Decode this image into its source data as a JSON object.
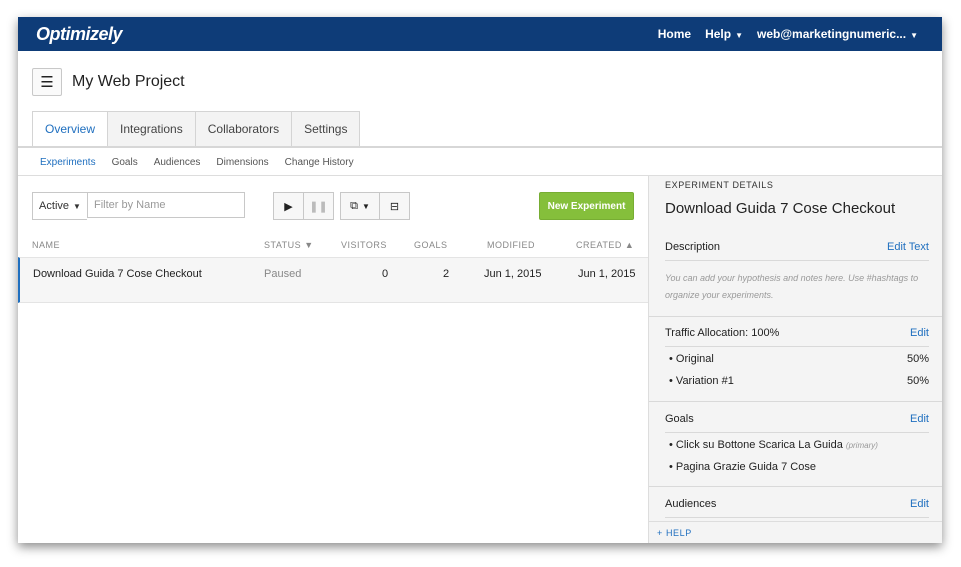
{
  "brand": {
    "logo": "Optimizely"
  },
  "topnav": {
    "home": "Home",
    "help": "Help",
    "account": "web@marketingnumeric..."
  },
  "project": {
    "title": "My Web Project"
  },
  "tabs": [
    "Overview",
    "Integrations",
    "Collaborators",
    "Settings"
  ],
  "subnav": [
    "Experiments",
    "Goals",
    "Audiences",
    "Dimensions",
    "Change History"
  ],
  "toolbar": {
    "status_value": "Active",
    "filter_placeholder": "Filter by Name",
    "new_experiment": "New Experiment"
  },
  "table": {
    "columns": [
      "NAME",
      "STATUS",
      "VISITORS",
      "GOALS",
      "MODIFIED",
      "CREATED"
    ],
    "rows": [
      {
        "name": "Download Guida 7 Cose Checkout",
        "status": "Paused",
        "visitors": "0",
        "goals": "2",
        "modified": "Jun 1, 2015",
        "created": "Jun 1, 2015"
      }
    ]
  },
  "details": {
    "section_label": "EXPERIMENT DETAILS",
    "title": "Download Guida 7 Cose Checkout",
    "description_label": "Description",
    "description_edit": "Edit Text",
    "description_hint": "You can add your hypothesis and notes here. Use #hashtags to organize your experiments.",
    "traffic_label": "Traffic Allocation: 100%",
    "traffic_edit": "Edit",
    "variations": [
      {
        "name": "Original",
        "pct": "50%"
      },
      {
        "name": "Variation #1",
        "pct": "50%"
      }
    ],
    "goals_label": "Goals",
    "goals_edit": "Edit",
    "goals": [
      {
        "name": "Click su Bottone Scarica La Guida",
        "tag": "(primary)"
      },
      {
        "name": "Pagina Grazie Guida 7 Cose",
        "tag": ""
      }
    ],
    "audiences_label": "Audiences",
    "audiences_edit": "Edit",
    "help": "+ HELP"
  },
  "colors": {
    "topbar": "#0e3c78",
    "accent": "#1f6fbf",
    "new_button": "#85bf3b"
  },
  "icons": [
    "hamburger-icon",
    "play-icon",
    "pause-icon",
    "duplicate-icon",
    "archive-icon",
    "caret-down-icon",
    "sort-asc-icon"
  ]
}
